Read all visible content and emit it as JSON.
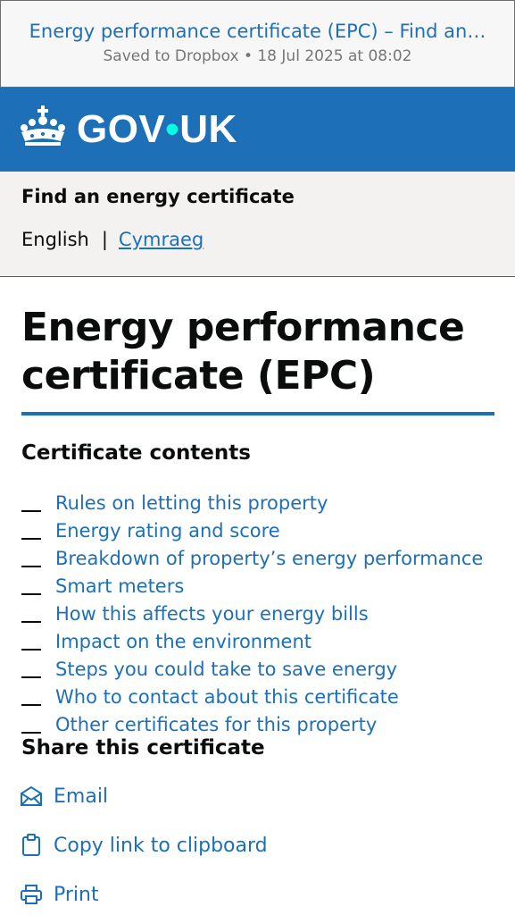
{
  "browser": {
    "title": "Energy performance certificate (EPC) – Find an…",
    "subtitle": "Saved to Dropbox • 18 Jul 2025 at 08:02"
  },
  "header": {
    "logo_text_1": "GOV",
    "logo_dot": "•",
    "logo_text_2": "UK"
  },
  "service": {
    "name": "Find an energy certificate",
    "lang_current": "English",
    "lang_sep": "|",
    "lang_other": "Cymraeg"
  },
  "page": {
    "title": "Energy performance certificate (EPC)",
    "contents_heading": "Certificate contents",
    "contents": [
      "Rules on letting this property",
      "Energy rating and score",
      "Breakdown of property’s energy performance",
      "Smart meters",
      "How this affects your energy bills",
      "Impact on the environment",
      "Steps you could take to save energy",
      "Who to contact about this certificate",
      "Other certificates for this property"
    ],
    "share_heading": "Share this certificate",
    "share": [
      {
        "label": "Email",
        "icon": "envelope-icon"
      },
      {
        "label": "Copy link to clipboard",
        "icon": "clipboard-icon"
      },
      {
        "label": "Print",
        "icon": "printer-icon"
      }
    ]
  },
  "colors": {
    "link": "#1d70b8",
    "header_bg": "#1d70b8",
    "logo_dot": "#00ffe0",
    "text": "#0b0c0c",
    "service_bg": "#f3f2f1"
  }
}
